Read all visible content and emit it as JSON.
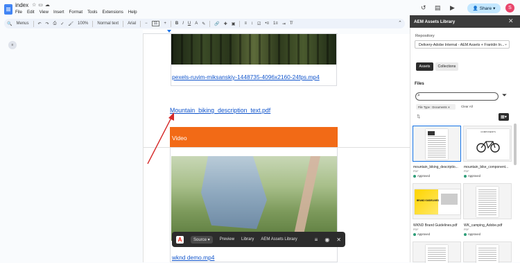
{
  "doc": {
    "title": "index",
    "menu": [
      "File",
      "Edit",
      "View",
      "Insert",
      "Format",
      "Tools",
      "Extensions",
      "Help"
    ],
    "share_label": "Share",
    "avatar_letter": "S"
  },
  "toolbar": {
    "search_menus": "Menus",
    "zoom": "100%",
    "style": "Normal text",
    "font": "Arial",
    "font_size": "11"
  },
  "content": {
    "video_link_1": "pexels-ruvim-miksanskiy-1448735-4096x2160-24fps.mp4",
    "pdf_link": "Mountain_biking_description_text.pdf",
    "video_header": "Video",
    "video_link_2": "wknd demo.mp4"
  },
  "floating_bar": {
    "source": "Source",
    "preview": "Preview",
    "library": "Library",
    "assets_library": "AEM Assets Library"
  },
  "panel": {
    "title": "AEM Assets Library",
    "repo_label": "Repository",
    "repo_value": "Delivery-Adobe Internal - AEM Assets + Franklin In...",
    "tab_assets": "Assets",
    "tab_collections": "Collections",
    "files_title": "Files",
    "filter_chip": "File Type : Documents",
    "clear_all": "Clear All",
    "cards": [
      {
        "name": "mountain_biking_descriptio...",
        "type": "PDF",
        "status": "Approved"
      },
      {
        "name": "mountain_bike_component...",
        "type": "PDF",
        "status": "Approved"
      },
      {
        "name": "WKND Brand Guidelines.pdf",
        "type": "PDF",
        "status": "Approved"
      },
      {
        "name": "WK_camping_Adobe.pdf",
        "type": "PDF",
        "status": "Approved"
      }
    ],
    "card_texts": {
      "components": "COMPONENTS",
      "brand": "BRAND GUIDELINES"
    }
  },
  "colors": {
    "video_header": "#f26a16",
    "link": "#1155cc",
    "panel_header": "#3b3b3b",
    "arrow": "#d62b2b"
  }
}
